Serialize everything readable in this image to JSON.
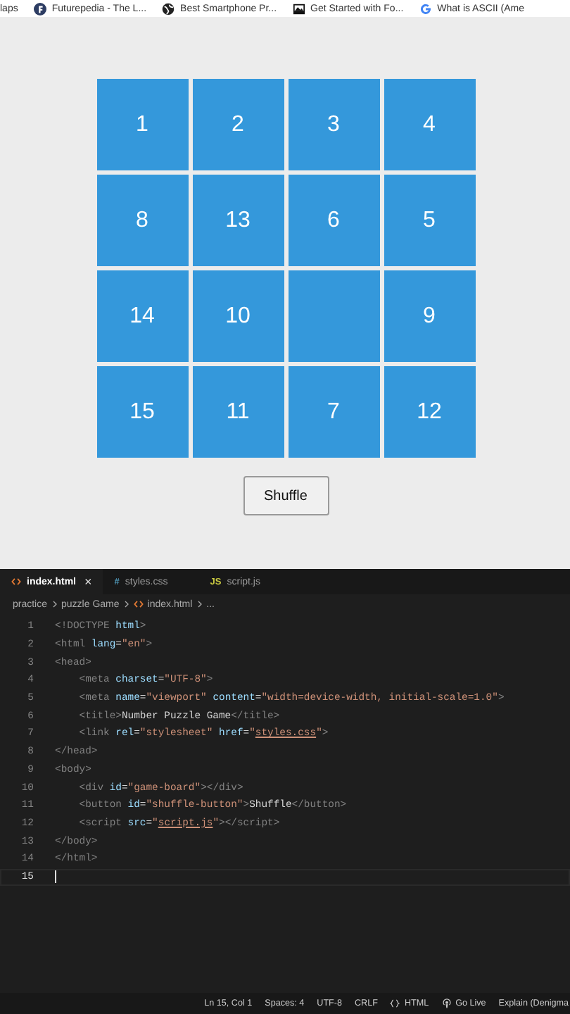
{
  "bookmarks": [
    {
      "label": "laps",
      "kind": "none"
    },
    {
      "label": "Futurepedia - The L...",
      "kind": "badge"
    },
    {
      "label": "Best Smartphone Pr...",
      "kind": "globe"
    },
    {
      "label": "Get Started with Fo...",
      "kind": "image"
    },
    {
      "label": "What is ASCII (Ame",
      "kind": "g"
    }
  ],
  "board": {
    "tiles": [
      {
        "number": "1"
      },
      {
        "number": "2"
      },
      {
        "number": "3"
      },
      {
        "number": "4"
      },
      {
        "number": "8"
      },
      {
        "number": "13"
      },
      {
        "number": "6"
      },
      {
        "number": "5"
      },
      {
        "number": "14"
      },
      {
        "number": "10"
      },
      {
        "kind": "empty"
      },
      {
        "number": "9"
      },
      {
        "number": "15"
      },
      {
        "number": "11"
      },
      {
        "number": "7"
      },
      {
        "number": "12"
      }
    ]
  },
  "shuffle_button": "Shuffle",
  "editor": {
    "tabs": [
      {
        "label": "index.html",
        "kind": "html",
        "selected": true,
        "close": "×"
      },
      {
        "label": "styles.css",
        "kind": "css",
        "icon": "#",
        "selected": false
      },
      {
        "label": "script.js",
        "kind": "js",
        "icon": "JS",
        "selected": false
      }
    ],
    "breadcrumbs": [
      {
        "label": "practice",
        "kind": "text"
      },
      {
        "label": "puzzle Game",
        "kind": "text"
      },
      {
        "label": "index.html",
        "kind": "html"
      },
      {
        "label": "...",
        "kind": "text"
      }
    ],
    "lines": [
      {
        "number": "1",
        "tokens": [
          {
            "text": "<!DOCTYPE ",
            "kind": "tag"
          },
          {
            "text": "html",
            "kind": "attr"
          },
          {
            "text": ">",
            "kind": "tag"
          }
        ]
      },
      {
        "number": "2",
        "tokens": [
          {
            "text": "<html ",
            "kind": "tag"
          },
          {
            "text": "lang",
            "kind": "attr"
          },
          {
            "text": "=",
            "kind": "plain"
          },
          {
            "text": "\"en\"",
            "kind": "str"
          },
          {
            "text": ">",
            "kind": "tag"
          }
        ]
      },
      {
        "number": "3",
        "tokens": [
          {
            "text": "<head>",
            "kind": "tag"
          }
        ]
      },
      {
        "number": "4",
        "tokens": [
          {
            "text": "    <meta ",
            "kind": "tag"
          },
          {
            "text": "charset",
            "kind": "attr"
          },
          {
            "text": "=",
            "kind": "plain"
          },
          {
            "text": "\"UTF-8\"",
            "kind": "str"
          },
          {
            "text": ">",
            "kind": "tag"
          }
        ]
      },
      {
        "number": "5",
        "tokens": [
          {
            "text": "    <meta ",
            "kind": "tag"
          },
          {
            "text": "name",
            "kind": "attr"
          },
          {
            "text": "=",
            "kind": "plain"
          },
          {
            "text": "\"viewport\" ",
            "kind": "str"
          },
          {
            "text": "content",
            "kind": "attr"
          },
          {
            "text": "=",
            "kind": "plain"
          },
          {
            "text": "\"width=device-width, initial-scale=1.0\"",
            "kind": "str"
          },
          {
            "text": ">",
            "kind": "tag"
          }
        ]
      },
      {
        "number": "6",
        "tokens": [
          {
            "text": "    <title>",
            "kind": "tag"
          },
          {
            "text": "Number Puzzle Game",
            "kind": "plain"
          },
          {
            "text": "</title>",
            "kind": "tag"
          }
        ]
      },
      {
        "number": "7",
        "tokens": [
          {
            "text": "    <link ",
            "kind": "tag"
          },
          {
            "text": "rel",
            "kind": "attr"
          },
          {
            "text": "=",
            "kind": "plain"
          },
          {
            "text": "\"stylesheet\" ",
            "kind": "str"
          },
          {
            "text": "href",
            "kind": "attr"
          },
          {
            "text": "=",
            "kind": "plain"
          },
          {
            "text": "\"",
            "kind": "str"
          },
          {
            "text": "styles.css",
            "kind": "link"
          },
          {
            "text": "\"",
            "kind": "str"
          },
          {
            "text": ">",
            "kind": "tag"
          }
        ]
      },
      {
        "number": "8",
        "tokens": [
          {
            "text": "</head>",
            "kind": "tag"
          }
        ]
      },
      {
        "number": "9",
        "tokens": [
          {
            "text": "<body>",
            "kind": "tag"
          }
        ]
      },
      {
        "number": "10",
        "tokens": [
          {
            "text": "    <div ",
            "kind": "tag"
          },
          {
            "text": "id",
            "kind": "attr"
          },
          {
            "text": "=",
            "kind": "plain"
          },
          {
            "text": "\"game-board\"",
            "kind": "str"
          },
          {
            "text": "></div>",
            "kind": "tag"
          }
        ]
      },
      {
        "number": "11",
        "tokens": [
          {
            "text": "    <button ",
            "kind": "tag"
          },
          {
            "text": "id",
            "kind": "attr"
          },
          {
            "text": "=",
            "kind": "plain"
          },
          {
            "text": "\"shuffle-button\"",
            "kind": "str"
          },
          {
            "text": ">",
            "kind": "tag"
          },
          {
            "text": "Shuffle",
            "kind": "plain"
          },
          {
            "text": "</button>",
            "kind": "tag"
          }
        ]
      },
      {
        "number": "12",
        "tokens": [
          {
            "text": "    <script ",
            "kind": "tag"
          },
          {
            "text": "src",
            "kind": "attr"
          },
          {
            "text": "=",
            "kind": "plain"
          },
          {
            "text": "\"",
            "kind": "str"
          },
          {
            "text": "script.js",
            "kind": "link"
          },
          {
            "text": "\"",
            "kind": "str"
          },
          {
            "text": "></script>",
            "kind": "tag"
          }
        ]
      },
      {
        "number": "13",
        "tokens": [
          {
            "text": "</body>",
            "kind": "tag"
          }
        ]
      },
      {
        "number": "14",
        "tokens": [
          {
            "text": "</html>",
            "kind": "tag"
          }
        ]
      },
      {
        "number": "15",
        "current": true
      }
    ]
  },
  "status_bar": [
    {
      "label": "Ln 15, Col 1",
      "kind": "text"
    },
    {
      "label": "Spaces: 4",
      "kind": "text"
    },
    {
      "label": "UTF-8",
      "kind": "text"
    },
    {
      "label": "CRLF",
      "kind": "text"
    },
    {
      "label": "HTML",
      "kind": "braces"
    },
    {
      "label": "Go Live",
      "kind": "broadcast"
    },
    {
      "label": "Explain (Denigma",
      "kind": "text"
    }
  ]
}
